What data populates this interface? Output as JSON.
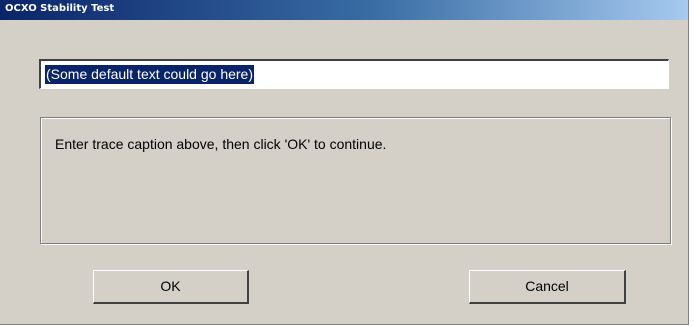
{
  "window": {
    "title": "OCXO Stability Test"
  },
  "caption_input": {
    "value": "(Some default text could go here)",
    "selected": true
  },
  "message": {
    "text": "Enter trace caption above, then click 'OK' to continue."
  },
  "buttons": {
    "ok_label": "OK",
    "cancel_label": "Cancel"
  },
  "colors": {
    "dialog_background": "#d4d0c8",
    "titlebar_start": "#0a246a",
    "titlebar_end": "#a6caf0",
    "selection_background": "#0a246a",
    "selection_text": "#ffffff"
  }
}
